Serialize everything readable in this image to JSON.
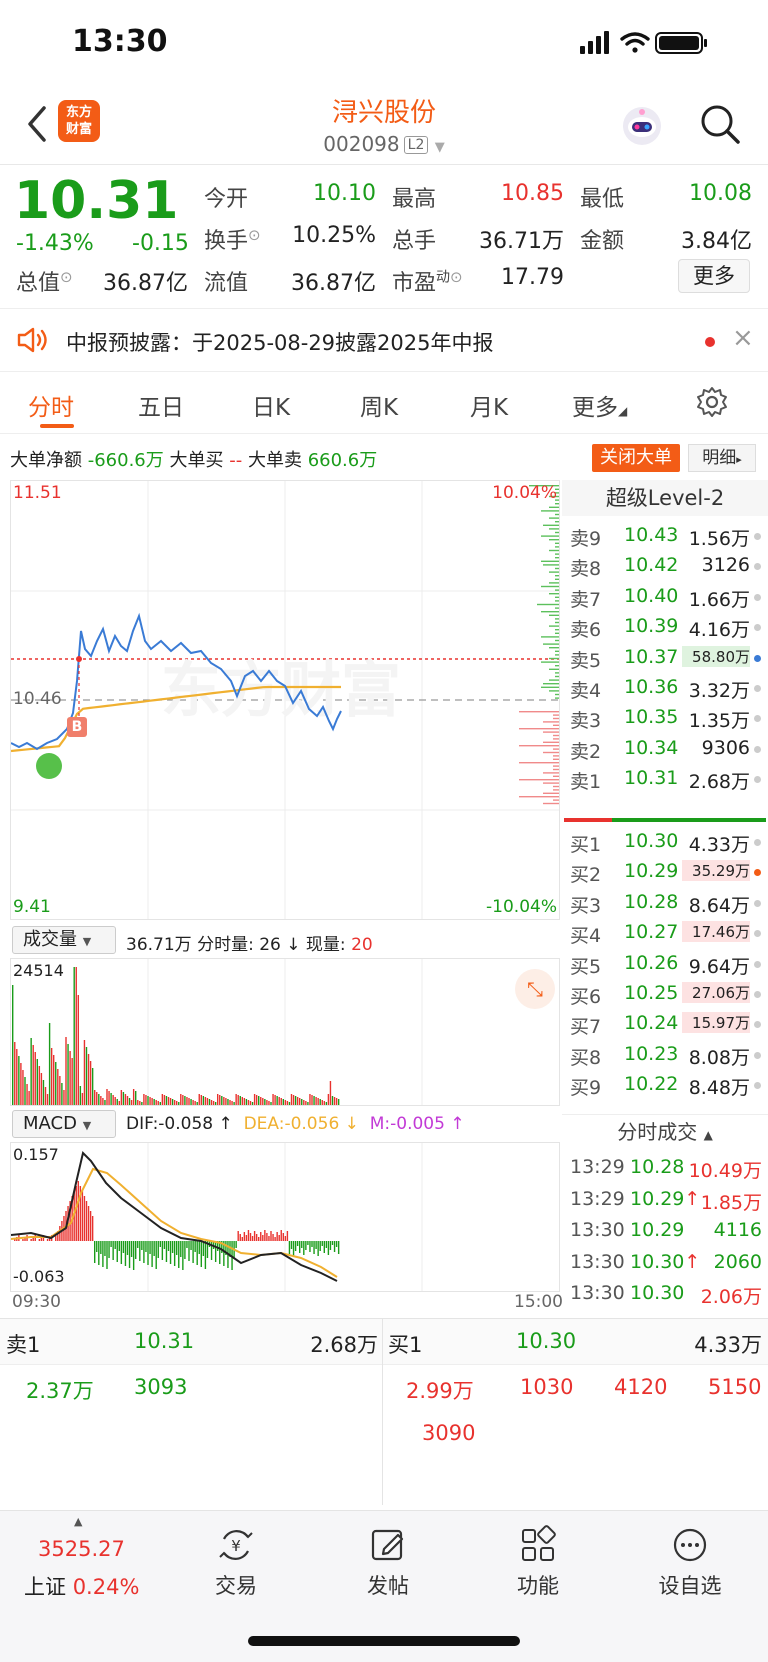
{
  "status": {
    "time": "13:30"
  },
  "header": {
    "logo_top": "东方",
    "logo_bottom": "财富",
    "stock_name": "浔兴股份",
    "stock_code": "002098",
    "level_badge": "L2"
  },
  "quote": {
    "price": "10.31",
    "change_pct": "-1.43%",
    "change": "-0.15",
    "open_label": "今开",
    "open": "10.10",
    "high_label": "最高",
    "high": "10.85",
    "low_label": "最低",
    "low": "10.08",
    "turnover_label": "换手",
    "turnover": "10.25%",
    "volume_label": "总手",
    "volume": "36.71万",
    "amount_label": "金额",
    "amount": "3.84亿",
    "mktcap_label": "总值",
    "mktcap": "36.87亿",
    "float_label": "流值",
    "float_cap": "36.87亿",
    "pe_label": "市盈",
    "pe_sup": "动",
    "pe": "17.79",
    "more_label": "更多"
  },
  "notice": {
    "text": "中报预披露：于2025-08-29披露2025年中报"
  },
  "tabs": [
    {
      "label": "分时"
    },
    {
      "label": "五日"
    },
    {
      "label": "日K"
    },
    {
      "label": "周K"
    },
    {
      "label": "月K"
    },
    {
      "label": "更多"
    }
  ],
  "bigorder": {
    "net_label": "大单净额",
    "net": "-660.6万",
    "buy_label": "大单买",
    "buy": "--",
    "sell_label": "大单卖",
    "sell": "660.6万",
    "close_label": "关闭大单",
    "detail_label": "明细"
  },
  "chart_labels": {
    "top_price": "11.51",
    "top_pct": "10.04%",
    "mid_price": "10.46",
    "bottom_price": "9.41",
    "bottom_pct": "-10.04%",
    "b_marker": "B",
    "watermark": "东方财富"
  },
  "volume_panel": {
    "select": "成交量",
    "total": "36.71万",
    "minute_label": "分时量:",
    "minute": "26",
    "now_label": "现量:",
    "now": "20",
    "max": "24514"
  },
  "macd_panel": {
    "select": "MACD",
    "dif": "DIF:-0.058",
    "dea": "DEA:-0.056",
    "m": "M:-0.005",
    "top": "0.157",
    "bottom": "-0.063",
    "start": "09:30",
    "end": "15:00"
  },
  "level2": {
    "title": "超级Level-2",
    "asks": [
      {
        "label": "卖9",
        "price": "10.43",
        "vol": "1.56万"
      },
      {
        "label": "卖8",
        "price": "10.42",
        "vol": "3126"
      },
      {
        "label": "卖7",
        "price": "10.40",
        "vol": "1.66万"
      },
      {
        "label": "卖6",
        "price": "10.39",
        "vol": "4.16万"
      },
      {
        "label": "卖5",
        "price": "10.37",
        "vol": "58.80万"
      },
      {
        "label": "卖4",
        "price": "10.36",
        "vol": "3.32万"
      },
      {
        "label": "卖3",
        "price": "10.35",
        "vol": "1.35万"
      },
      {
        "label": "卖2",
        "price": "10.34",
        "vol": "9306"
      },
      {
        "label": "卖1",
        "price": "10.31",
        "vol": "2.68万"
      }
    ],
    "bids": [
      {
        "label": "买1",
        "price": "10.30",
        "vol": "4.33万"
      },
      {
        "label": "买2",
        "price": "10.29",
        "vol": "35.29万"
      },
      {
        "label": "买3",
        "price": "10.28",
        "vol": "8.64万"
      },
      {
        "label": "买4",
        "price": "10.27",
        "vol": "17.46万"
      },
      {
        "label": "买5",
        "price": "10.26",
        "vol": "9.64万"
      },
      {
        "label": "买6",
        "price": "10.25",
        "vol": "27.06万"
      },
      {
        "label": "买7",
        "price": "10.24",
        "vol": "15.97万"
      },
      {
        "label": "买8",
        "price": "10.23",
        "vol": "8.08万"
      },
      {
        "label": "买9",
        "price": "10.22",
        "vol": "8.48万"
      }
    ],
    "trades_title": "分时成交",
    "trades": [
      {
        "time": "13:29",
        "price": "10.28",
        "vol": "10.49万",
        "arrow": ""
      },
      {
        "time": "13:29",
        "price": "10.29",
        "vol": "1.85万",
        "arrow": "↑"
      },
      {
        "time": "13:30",
        "price": "10.29",
        "vol": "4116",
        "arrow": ""
      },
      {
        "time": "13:30",
        "price": "10.30",
        "vol": "2060",
        "arrow": "↑"
      },
      {
        "time": "13:30",
        "price": "10.30",
        "vol": "2.06万",
        "arrow": ""
      }
    ]
  },
  "queue": {
    "ask_label": "卖1",
    "ask_price": "10.31",
    "ask_vol": "2.68万",
    "bid_label": "买1",
    "bid_price": "10.30",
    "bid_vol": "4.33万",
    "ask_orders": [
      "2.37万",
      "3093"
    ],
    "bid_orders": [
      "2.99万",
      "1030",
      "4120",
      "5150",
      "3090"
    ]
  },
  "tabbar": {
    "index_value": "3525.27",
    "index_name": "上证",
    "index_pct": "0.24%",
    "items": [
      {
        "label": "交易"
      },
      {
        "label": "发帖"
      },
      {
        "label": "功能"
      },
      {
        "label": "设自选"
      }
    ]
  },
  "colors": {
    "accent": "#f35c16",
    "up": "#e8322e",
    "down": "#1a9c1a",
    "price_line": "#3a7bd5",
    "avg_line": "#f0b030"
  }
}
